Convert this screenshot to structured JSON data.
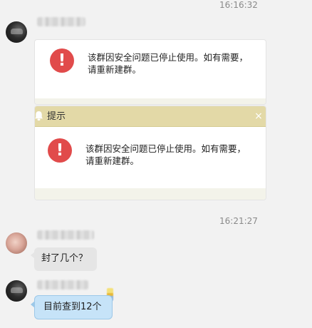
{
  "chat": {
    "timestamps": [
      "16:16:32",
      "16:21:27"
    ],
    "notice_card": {
      "message": "该群因安全问题已停止使用。如有需要，请重新建群。"
    },
    "dialog": {
      "title": "提示",
      "close_symbol": "×",
      "message": "该群因安全问题已停止使用。如有需要，请重新建群。"
    },
    "messages": [
      {
        "text": "封了几个？"
      },
      {
        "text": "目前查到12个"
      }
    ]
  },
  "colors": {
    "error_red": "#e14b4b",
    "titlebar": "#e3d9a7",
    "bubble_blue": "#c6e3f8",
    "bubble_gray": "#e5e5e5"
  },
  "icons": [
    "error-icon",
    "bell-icon",
    "close-icon",
    "sticker-icon"
  ]
}
